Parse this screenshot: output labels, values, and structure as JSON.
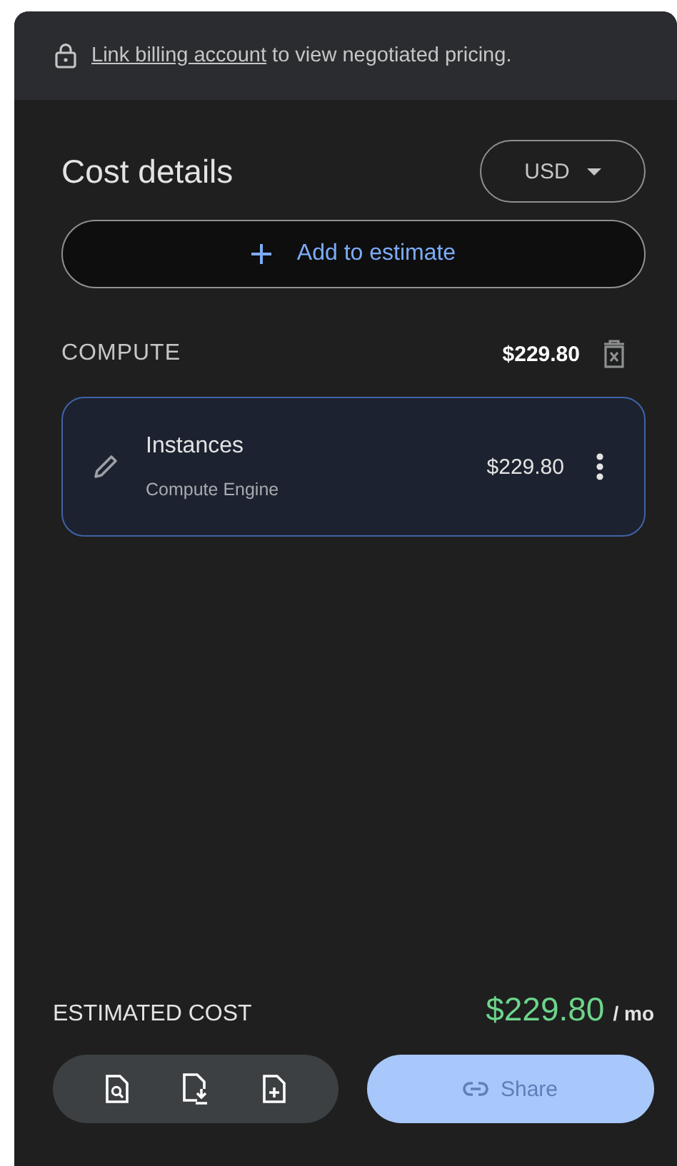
{
  "banner": {
    "link": "Link billing account",
    "text": " to view negotiated pricing."
  },
  "header": {
    "title": "Cost details",
    "currency": "USD"
  },
  "add_button": {
    "label": "Add to estimate"
  },
  "sections": [
    {
      "name": "COMPUTE",
      "total": "$229.80",
      "items": [
        {
          "title": "Instances",
          "subtitle": "Compute Engine",
          "price": "$229.80",
          "selected": true
        }
      ]
    }
  ],
  "estimate": {
    "label": "ESTIMATED COST",
    "amount": "$229.80",
    "unit": "/ mo"
  },
  "share": {
    "label": "Share",
    "disabled": true
  }
}
